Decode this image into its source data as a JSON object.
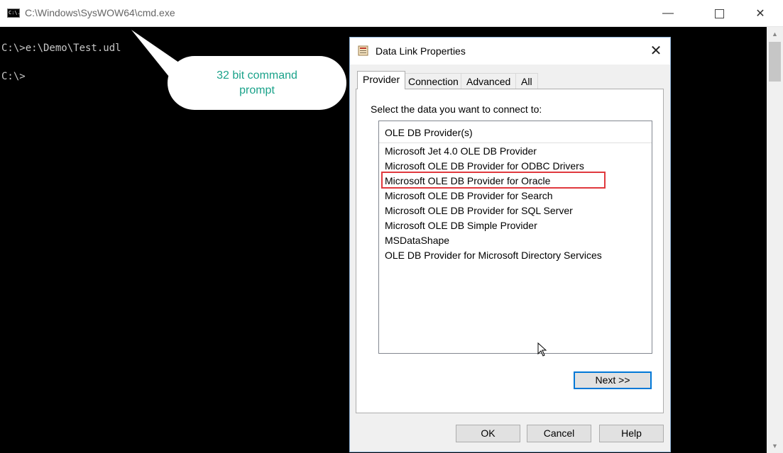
{
  "cmd": {
    "title": "C:\\Windows\\SysWOW64\\cmd.exe",
    "icon_text": "C:\\.",
    "lines": [
      "C:\\>e:\\Demo\\Test.udl",
      "C:\\>"
    ],
    "minimize_glyph": "—",
    "close_glyph": "✕"
  },
  "callout": {
    "text": "32 bit command prompt"
  },
  "dialog": {
    "title": "Data Link Properties",
    "close_glyph": "✕",
    "tabs": [
      {
        "label": "Provider",
        "active": true
      },
      {
        "label": "Connection",
        "active": false
      },
      {
        "label": "Advanced",
        "active": false
      },
      {
        "label": "All",
        "active": false
      }
    ],
    "prompt": "Select the data you want to connect to:",
    "list": {
      "header": "OLE DB Provider(s)",
      "items": [
        "Microsoft Jet 4.0 OLE DB Provider",
        "Microsoft OLE DB Provider for ODBC Drivers",
        "Microsoft OLE DB Provider for Oracle",
        "Microsoft OLE DB Provider for Search",
        "Microsoft OLE DB Provider for SQL Server",
        "Microsoft OLE DB Simple Provider",
        "MSDataShape",
        "OLE DB Provider for Microsoft Directory Services"
      ],
      "highlighted_item": "Microsoft OLE DB Provider for Oracle"
    },
    "next_button": "Next >>",
    "ok_button": "OK",
    "cancel_button": "Cancel",
    "help_button": "Help"
  },
  "colors": {
    "callout_text": "#1aa28a",
    "highlight_border": "#e0393e",
    "focus_border": "#0078d7"
  }
}
